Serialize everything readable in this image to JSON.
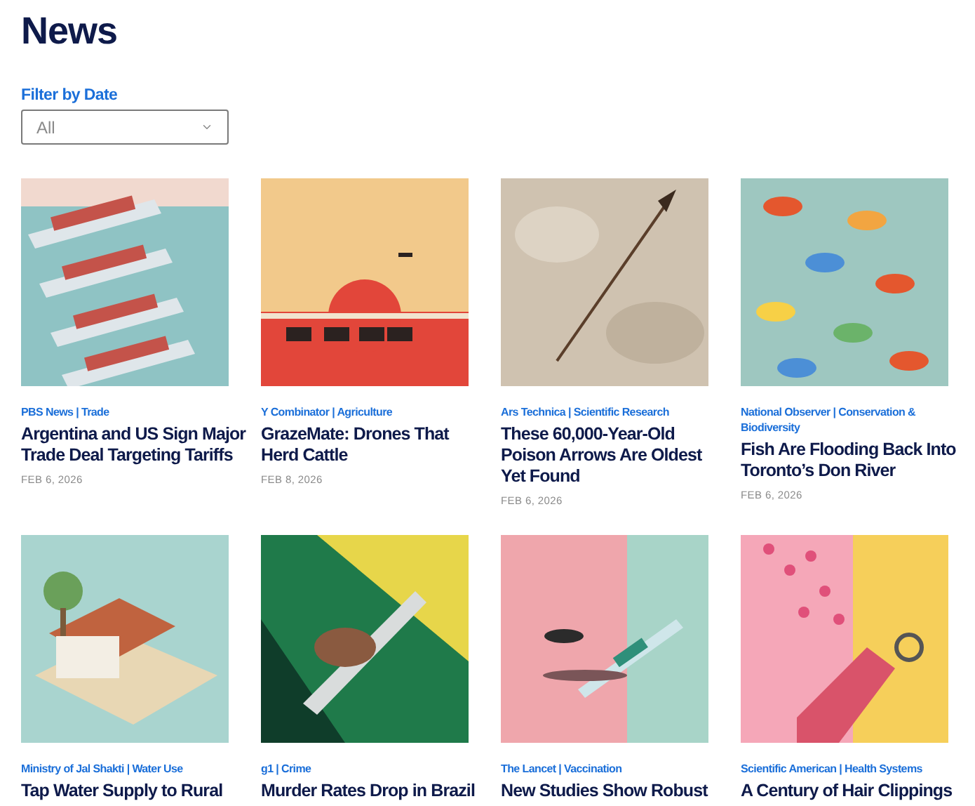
{
  "heading": "News",
  "filter": {
    "label": "Filter by Date",
    "value": "All"
  },
  "articles": [
    {
      "source": "PBS News | Trade",
      "title": "Argentina and US Sign Major Trade Deal Targeting Tariffs",
      "date": "FEB 6, 2026"
    },
    {
      "source": "Y Combinator | Agriculture",
      "title": "GrazeMate: Drones That Herd Cattle",
      "date": "FEB 8, 2026"
    },
    {
      "source": "Ars Technica | Scientific Research",
      "title": "These 60,000-Year-Old Poison Arrows Are Oldest Yet Found",
      "date": "FEB 6, 2026"
    },
    {
      "source": "National Observer | Conservation & Biodiversity",
      "title": "Fish Are Flooding Back Into Toronto’s Don River",
      "date": "FEB 6, 2026"
    },
    {
      "source": "Ministry of Jal Shakti | Water Use",
      "title": "Tap Water Supply to Rural"
    },
    {
      "source": "g1 | Crime",
      "title": "Murder Rates Drop in Brazil"
    },
    {
      "source": "The Lancet | Vaccination",
      "title": "New Studies Show Robust"
    },
    {
      "source": "Scientific American | Health Systems",
      "title": "A Century of Hair Clippings"
    }
  ]
}
